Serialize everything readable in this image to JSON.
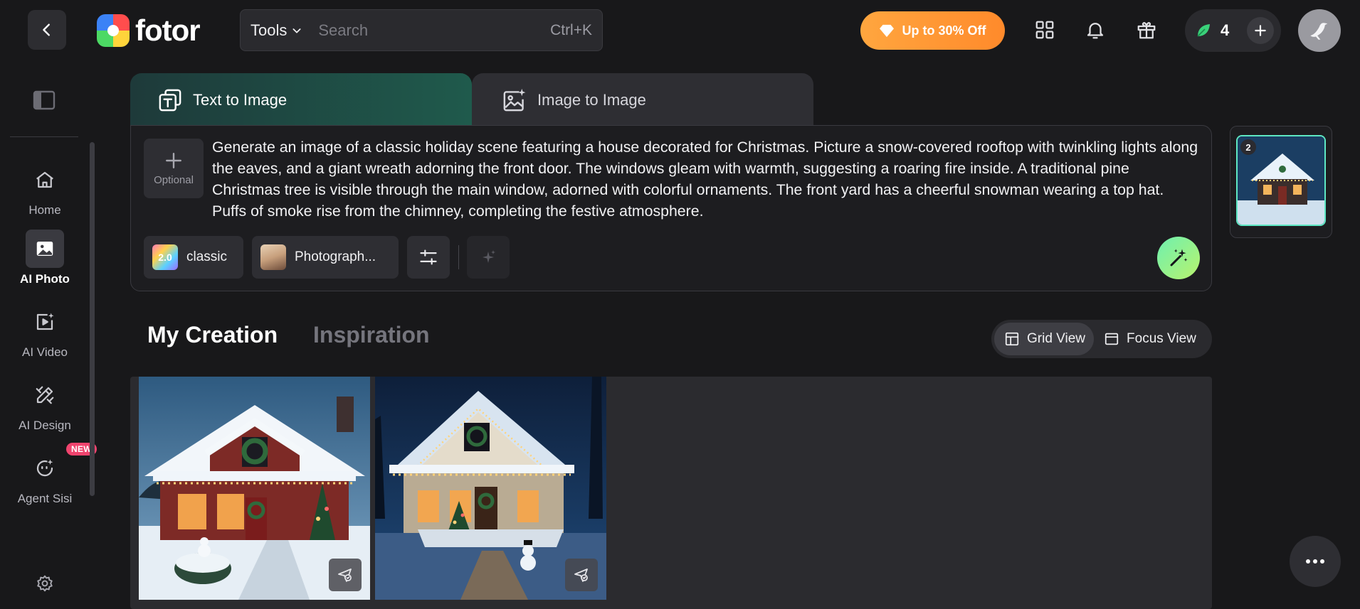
{
  "header": {
    "back_icon": "chevron-left-icon",
    "logo_text": "fotor",
    "tools_label": "Tools",
    "search_placeholder": "Search",
    "search_shortcut": "Ctrl+K",
    "promo_label": "Up to 30% Off",
    "credits_count": "4"
  },
  "sidebar": {
    "items": [
      {
        "label": "Home",
        "icon": "home-icon"
      },
      {
        "label": "AI Photo",
        "icon": "image-icon"
      },
      {
        "label": "AI Video",
        "icon": "video-icon"
      },
      {
        "label": "AI Design",
        "icon": "design-icon"
      },
      {
        "label": "Agent Sisi",
        "icon": "agent-icon",
        "badge": "NEW"
      }
    ],
    "active_index": 1
  },
  "mode_tabs": [
    {
      "label": "Text to Image",
      "active": true
    },
    {
      "label": "Image to Image",
      "active": false
    }
  ],
  "prompt": {
    "add_reference_label": "Optional",
    "text": "Generate an image of a classic holiday scene featuring a house decorated for Christmas. Picture a snow-covered rooftop with twinkling lights along the eaves, and a giant wreath adorning the front door. The windows gleam with warmth, suggesting a roaring fire inside. A traditional pine Christmas tree is visible through the main window, adorned with colorful ornaments. The front yard has a cheerful snowman wearing a top hat. Puffs of smoke rise from the chimney, completing the festive atmosphere.",
    "model_badge": "2.0",
    "model_label": "classic",
    "style_label": "Photograph..."
  },
  "history": {
    "count": "2"
  },
  "creation_tabs": [
    {
      "label": "My Creation",
      "active": true
    },
    {
      "label": "Inspiration",
      "active": false
    }
  ],
  "view_toggle": {
    "grid_label": "Grid View",
    "focus_label": "Focus View",
    "active": "grid"
  },
  "colors": {
    "background": "#18181a",
    "panel": "#1d1d20",
    "accent_green": "#5ee8c4",
    "promo_orange": "#ff8a2b",
    "badge_pink": "#f0446e"
  }
}
